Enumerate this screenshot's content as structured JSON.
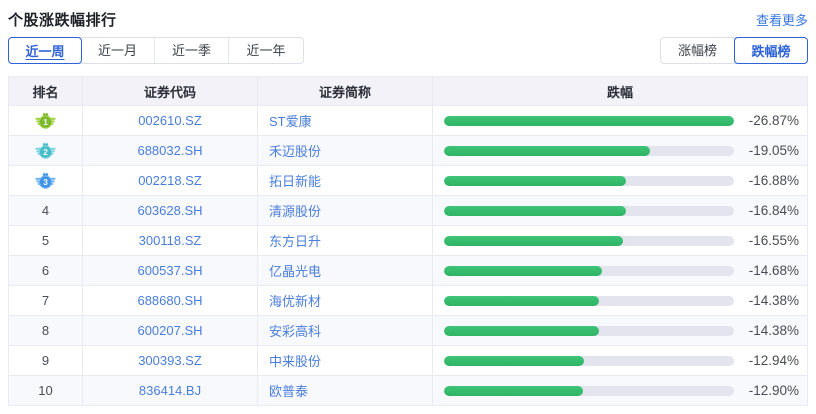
{
  "page": {
    "title": "个股涨跌幅排行",
    "more_link": "查看更多"
  },
  "period_tabs": [
    {
      "label": "近一周",
      "active": true
    },
    {
      "label": "近一月",
      "active": false
    },
    {
      "label": "近一季",
      "active": false
    },
    {
      "label": "近一年",
      "active": false
    }
  ],
  "board_toggle": [
    {
      "label": "涨幅榜",
      "active": false
    },
    {
      "label": "跌幅榜",
      "active": true
    }
  ],
  "table": {
    "headers": {
      "rank": "排名",
      "code": "证券代码",
      "name": "证券简称",
      "change": "跌幅"
    },
    "max_value": 26.87,
    "rows": [
      {
        "rank": 1,
        "code": "002610.SZ",
        "name": "ST爱康",
        "change": "-26.87%",
        "value": 26.87
      },
      {
        "rank": 2,
        "code": "688032.SH",
        "name": "禾迈股份",
        "change": "-19.05%",
        "value": 19.05
      },
      {
        "rank": 3,
        "code": "002218.SZ",
        "name": "拓日新能",
        "change": "-16.88%",
        "value": 16.88
      },
      {
        "rank": 4,
        "code": "603628.SH",
        "name": "清源股份",
        "change": "-16.84%",
        "value": 16.84
      },
      {
        "rank": 5,
        "code": "300118.SZ",
        "name": "东方日升",
        "change": "-16.55%",
        "value": 16.55
      },
      {
        "rank": 6,
        "code": "600537.SH",
        "name": "亿晶光电",
        "change": "-14.68%",
        "value": 14.68
      },
      {
        "rank": 7,
        "code": "688680.SH",
        "name": "海优新材",
        "change": "-14.38%",
        "value": 14.38
      },
      {
        "rank": 8,
        "code": "600207.SH",
        "name": "安彩高科",
        "change": "-14.38%",
        "value": 14.38
      },
      {
        "rank": 9,
        "code": "300393.SZ",
        "name": "中来股份",
        "change": "-12.94%",
        "value": 12.94
      },
      {
        "rank": 10,
        "code": "836414.BJ",
        "name": "欧普泰",
        "change": "-12.90%",
        "value": 12.9
      }
    ]
  },
  "colors": {
    "accent_blue": "#2e63d8",
    "link_blue": "#3877e6",
    "text_blue": "#4a7edb",
    "bar_green": "#34ba6c",
    "bar_track": "#e4e4ef",
    "header_bg": "#f2f2f8",
    "stripe_bg": "#f8f9fd",
    "border": "#e9eaf2",
    "pct_text": "#4a4c55",
    "medals": [
      {
        "light": "#a3d34a",
        "base": "#7cb92e"
      },
      {
        "light": "#7fd6de",
        "base": "#45bdc9"
      },
      {
        "light": "#79b7f2",
        "base": "#3f94e8"
      }
    ]
  }
}
